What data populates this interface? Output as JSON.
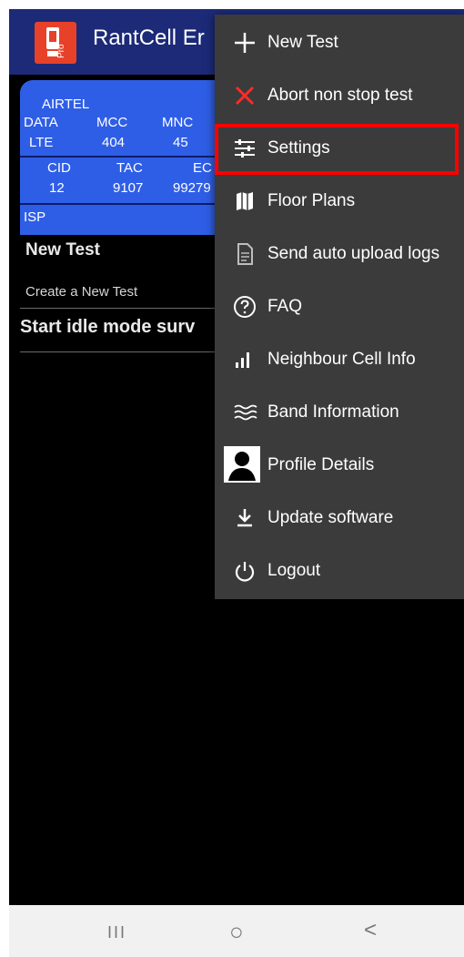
{
  "app": {
    "title": "RantCell Er",
    "logo_color": "#e8412a"
  },
  "card": {
    "operator": "AIRTEL",
    "headers": [
      "DATA",
      "MCC",
      "MNC"
    ],
    "values": [
      "LTE",
      "404",
      "45"
    ],
    "headers2": [
      "CID",
      "TAC",
      "EC"
    ],
    "values2": [
      "12",
      "9107",
      "99279"
    ],
    "isp_label": "ISP",
    "bg_color": "#2f5ee6"
  },
  "left_panel": {
    "new_test_title": "New Test",
    "new_test_subtitle": "Create a New Test",
    "idle_title": "Start idle mode surv"
  },
  "menu": {
    "items": [
      {
        "label": "New Test",
        "icon": "plus-icon"
      },
      {
        "label": "Abort non stop test",
        "icon": "close-icon"
      },
      {
        "label": "Settings",
        "icon": "sliders-icon"
      },
      {
        "label": "Floor Plans",
        "icon": "map-icon"
      },
      {
        "label": "Send auto upload logs",
        "icon": "document-icon"
      },
      {
        "label": "FAQ",
        "icon": "help-icon"
      },
      {
        "label": "Neighbour Cell Info",
        "icon": "signal-bars-icon"
      },
      {
        "label": "Band Information",
        "icon": "waves-icon"
      },
      {
        "label": "Profile Details",
        "icon": "profile-icon"
      },
      {
        "label": "Update software",
        "icon": "download-icon"
      },
      {
        "label": "Logout",
        "icon": "power-icon"
      }
    ],
    "highlighted": "Settings",
    "highlight_color": "#ff0000",
    "bg_color": "#3b3b3b"
  },
  "system_nav": {
    "recents": "III",
    "home": "○",
    "back": "<"
  }
}
